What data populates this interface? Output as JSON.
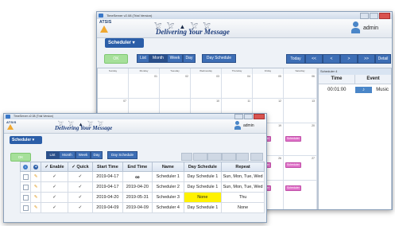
{
  "back_window": {
    "title": "TimeServer v2.08 (Trial Version)",
    "brand": "ATSIS",
    "tagline": "Delivering Your Message",
    "user": "admin",
    "scheduler_label": "Scheduler",
    "toolbar": {
      "ok": "OK",
      "list": "List",
      "month": "Month",
      "week": "Week",
      "day": "Day",
      "day_schedule": "Day Schedule",
      "today": "Today",
      "prev_fast": "<<",
      "prev": "<",
      "next": ">",
      "next_fast": ">>",
      "detail": "Detail"
    },
    "calendar": {
      "day_headers": [
        "Sunday",
        "Monday",
        "Tuesday",
        "Wednesday",
        "Thursday",
        "Friday",
        "Saturday"
      ],
      "week1": [
        "",
        "01",
        "02",
        "03",
        "04",
        "05",
        "06"
      ],
      "week2": [
        "07",
        "",
        "",
        "10",
        "11",
        "12",
        "13"
      ],
      "chips": {
        "tue_chip": "Scheduler 4",
        "fri_chip1": "Scheduler",
        "sat_chip1": "Scheduler",
        "fri_chip2": "Scheduler",
        "sat_chip2": "Scheduler",
        "fri_chip3": "Scheduler",
        "sat_chip3": "Scheduler"
      },
      "partial_nums": [
        "19",
        "20",
        "26",
        "27"
      ]
    },
    "side_panel": {
      "title": "Scheduler 4",
      "col_time": "Time",
      "col_event": "Event",
      "row_time": "00:01:00",
      "row_event": "Music"
    }
  },
  "front_window": {
    "title": "TimeServer v2.08 (Trial Version)",
    "brand": "ATSIS",
    "tagline": "Delivering Your Message",
    "user": "admin",
    "scheduler_label": "Scheduler",
    "toolbar": {
      "ok": "OK",
      "list": "List",
      "month": "Month",
      "week": "Week",
      "day": "Day",
      "day_schedule": "Day Schedule"
    },
    "table": {
      "headers": [
        "",
        "",
        "Enable",
        "Quick",
        "Start Time",
        "End Time",
        "Name",
        "Day Schedule",
        "Repeat"
      ],
      "rows": [
        {
          "start": "2019-04-17",
          "end": "∞",
          "name": "Scheduler 1",
          "day_schedule": "Day Schedule 1",
          "repeat": "Sun, Mon, Tue, Wed"
        },
        {
          "start": "2019-04-17",
          "end": "2019-04-20",
          "name": "Scheduler 2",
          "day_schedule": "Day Schedule 1",
          "repeat": "Sun, Mon, Tue, Wed"
        },
        {
          "start": "2019-04-20",
          "end": "2019-05-31",
          "name": "Scheduler 3",
          "day_schedule": "None",
          "repeat": "Thu"
        },
        {
          "start": "2019-04-09",
          "end": "2019-04-09",
          "name": "Scheduler 4",
          "day_schedule": "Day Schedule 1",
          "repeat": "None"
        }
      ]
    }
  },
  "colors": {
    "brand_blue": "#2b5ea8",
    "ok_green": "#a6e09a",
    "highlight_yellow": "#fff200",
    "chip_pink": "#e070c8",
    "chip_green": "#b8e6a8"
  }
}
